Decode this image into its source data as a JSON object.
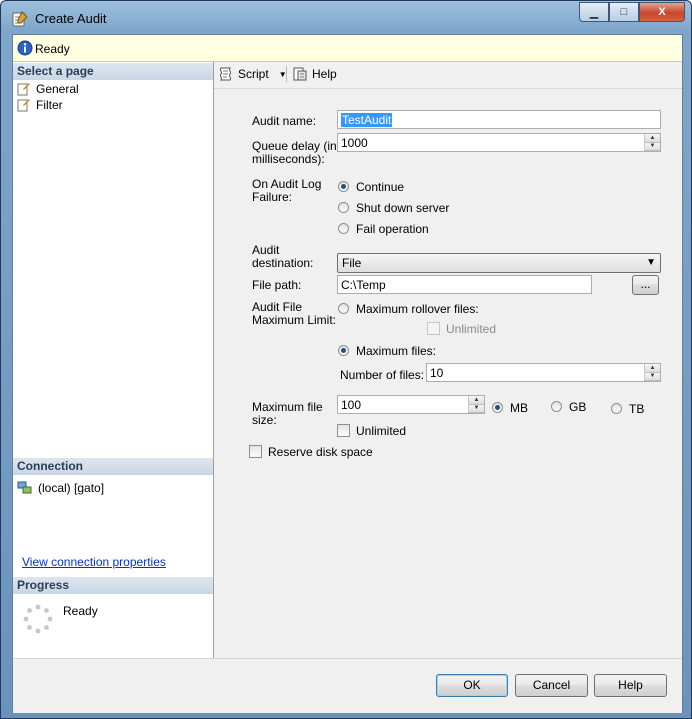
{
  "window": {
    "title": "Create Audit",
    "caption_buttons": {
      "minimize": "▁",
      "maximize": "□",
      "close": "X"
    }
  },
  "status": {
    "text": "Ready",
    "icon": "info-icon"
  },
  "left": {
    "select_page_header": "Select a page",
    "pages": [
      {
        "label": "General",
        "icon": "wrench-page-icon"
      },
      {
        "label": "Filter",
        "icon": "wrench-page-icon"
      }
    ],
    "connection_header": "Connection",
    "connection_item": "(local) [gato]",
    "view_connection_link": "View connection properties",
    "progress_header": "Progress",
    "progress_status": "Ready"
  },
  "toolbar": {
    "script_label": "Script",
    "help_label": "Help"
  },
  "form": {
    "audit_name_label": "Audit name:",
    "audit_name_value": "TestAudit",
    "queue_delay_label_line1": "Queue delay (in",
    "queue_delay_label_line2": "milliseconds):",
    "queue_delay_value": "1000",
    "on_failure_label_line1": "On Audit Log",
    "on_failure_label_line2": "Failure:",
    "failure_options": [
      "Continue",
      "Shut down server",
      "Fail operation"
    ],
    "failure_selected": "Continue",
    "audit_destination_label_line1": "Audit",
    "audit_destination_label_line2": "destination:",
    "audit_destination_value": "File",
    "file_path_label": "File path:",
    "file_path_value": "C:\\Temp",
    "browse_button": "...",
    "max_limit_label_line1": "Audit File",
    "max_limit_label_line2": "Maximum Limit:",
    "max_rollover_label": "Maximum rollover files:",
    "unlimited_rollover_label": "Unlimited",
    "max_files_label": "Maximum files:",
    "number_of_files_label": "Number of files:",
    "number_of_files_value": "10",
    "max_file_size_label_line1": "Maximum file",
    "max_file_size_label_line2": "size:",
    "max_file_size_value": "100",
    "size_units": [
      "MB",
      "GB",
      "TB"
    ],
    "size_unit_selected": "MB",
    "unlimited_size_label": "Unlimited",
    "reserve_disk_label": "Reserve disk space"
  },
  "footer": {
    "ok_label": "OK",
    "cancel_label": "Cancel",
    "help_label": "Help"
  }
}
